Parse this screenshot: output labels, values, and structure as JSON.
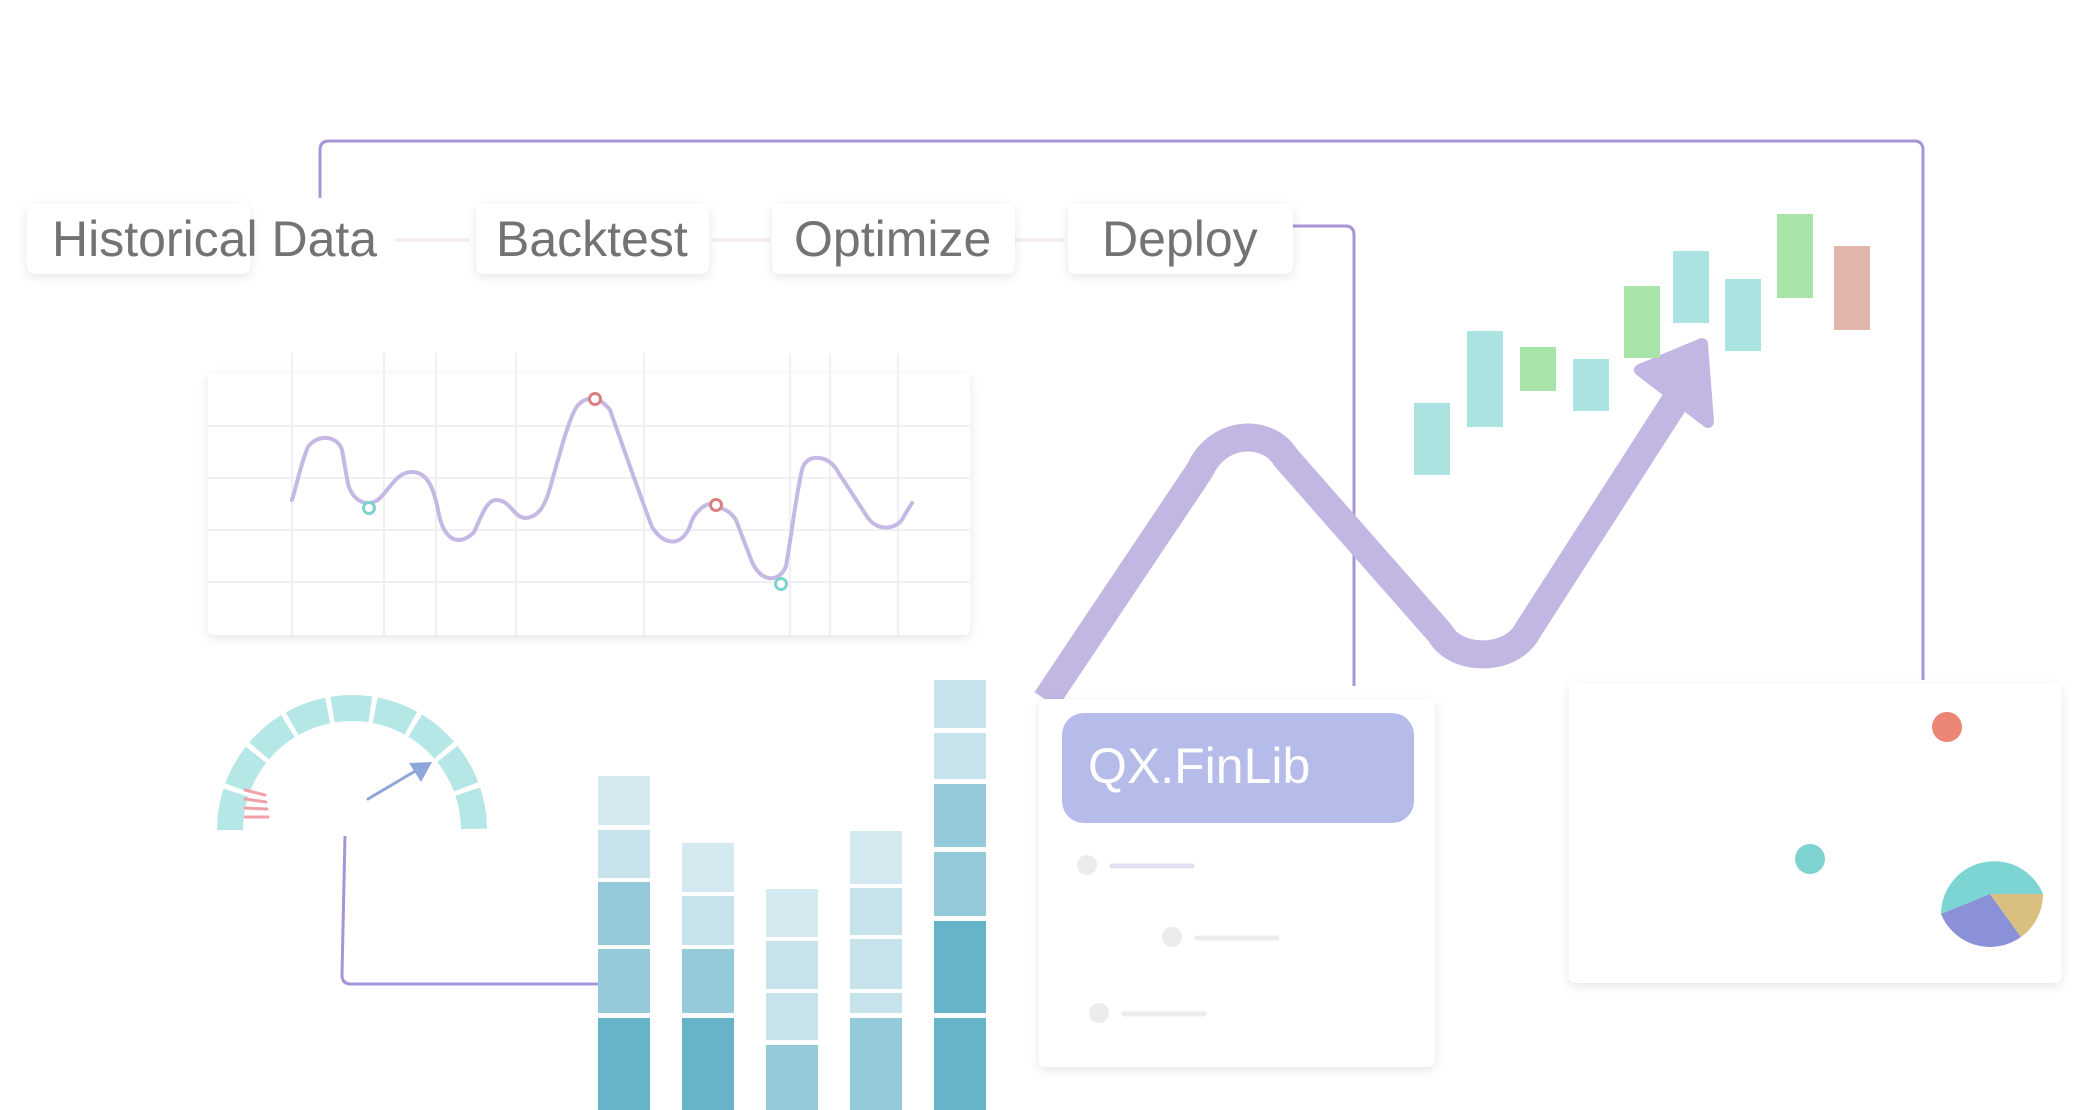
{
  "pipeline": {
    "steps": [
      {
        "label": "Historical Data"
      },
      {
        "label": "Backtest"
      },
      {
        "label": "Optimize"
      },
      {
        "label": "Deploy"
      }
    ]
  },
  "library": {
    "name": "QX.FinLib",
    "list_item_count": 3
  },
  "colors": {
    "accent_purple": "#c2b6e3",
    "connector": "#a894d8",
    "library_header": "#b6bcea",
    "teal": "#abe3e1",
    "green": "#a8e3a8",
    "salmon": "#e3b6ab",
    "text_gray": "#737373"
  },
  "icons": [
    "line-chart-icon",
    "gauge-icon",
    "stacked-bars-icon",
    "trend-arrow-icon",
    "candlestick-icon",
    "pie-chart-icon"
  ]
}
